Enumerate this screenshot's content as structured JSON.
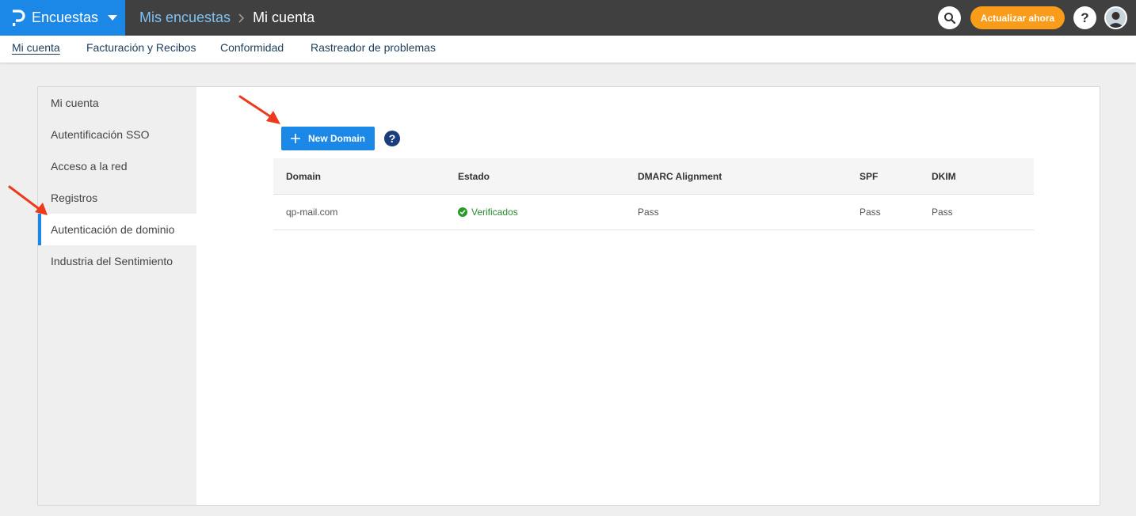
{
  "topbar": {
    "brand_label": "Encuestas",
    "breadcrumb_parent": "Mis encuestas",
    "breadcrumb_current": "Mi cuenta",
    "upgrade_label": "Actualizar ahora",
    "help_label": "?",
    "colors": {
      "bar": "#404040",
      "brand": "#1b87e6",
      "upgrade": "#f99c1a"
    }
  },
  "subnav": {
    "items": [
      {
        "label": "Mi cuenta",
        "active": true
      },
      {
        "label": "Facturación y Recibos"
      },
      {
        "label": "Conformidad"
      },
      {
        "label": "Rastreador de problemas"
      }
    ]
  },
  "sidebar": {
    "items": [
      {
        "label": "Mi cuenta"
      },
      {
        "label": "Autentificación SSO"
      },
      {
        "label": "Acceso a la red"
      },
      {
        "label": "Registros"
      },
      {
        "label": "Autenticación de dominio",
        "active": true
      },
      {
        "label": "Industria del Sentimiento"
      }
    ]
  },
  "main": {
    "new_domain_label": "New Domain",
    "help_icon_label": "?",
    "table": {
      "headers": [
        "Domain",
        "Estado",
        "DMARC Alignment",
        "SPF",
        "DKIM"
      ],
      "rows": [
        {
          "domain": "qp-mail.com",
          "estado": "Verificados",
          "dmarc": "Pass",
          "spf": "Pass",
          "dkim": "Pass"
        }
      ]
    }
  },
  "icons": [
    "logo-icon",
    "chevron-down-icon",
    "chevron-right-icon",
    "search-icon",
    "help-icon",
    "avatar",
    "plus-icon",
    "check-circle-icon",
    "arrow-annotation-icon"
  ]
}
